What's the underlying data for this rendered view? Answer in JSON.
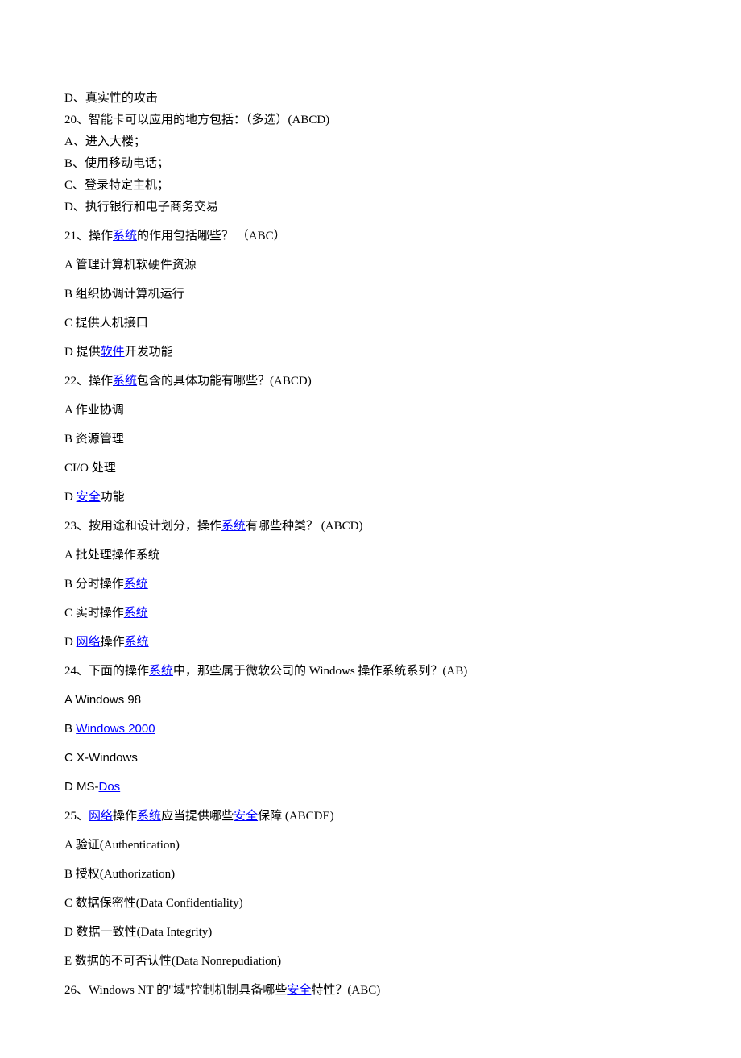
{
  "lines": {
    "l1": "D、真实性的攻击",
    "l2": "20、智能卡可以应用的地方包括：（多选）(ABCD)",
    "l3": "A、进入大楼；",
    "l4": "B、使用移动电话；",
    "l5": "C、登录特定主机；",
    "l6": "D、执行银行和电子商务交易",
    "l7a": "21、操作",
    "l7_link": "系统",
    "l7b": "的作用包括哪些？ （ABC）",
    "l8": "A 管理计算机软硬件资源",
    "l9": "B 组织协调计算机运行",
    "l10": "C 提供人机接口",
    "l11a": "D 提供",
    "l11_link": "软件",
    "l11b": "开发功能",
    "l12a": "22、操作",
    "l12_link": "系统",
    "l12b": "包含的具体功能有哪些？(ABCD)",
    "l13": "A 作业协调",
    "l14": "B 资源管理",
    "l15": "CI/O 处理",
    "l16a": "D ",
    "l16_link": "安全",
    "l16b": "功能",
    "l17a": "23、按用途和设计划分，操作",
    "l17_link": "系统",
    "l17b": "有哪些种类？   (ABCD)",
    "l18": "A 批处理操作系统",
    "l19a": "B 分时操作",
    "l19_link": "系统",
    "l20a": "C 实时操作",
    "l20_link": "系统",
    "l21a": "D ",
    "l21_link1": "网络",
    "l21b": "操作",
    "l21_link2": "系统",
    "l22a": "24、下面的操作",
    "l22_link": "系统",
    "l22b": "中，那些属于微软公司的 Windows 操作系统系列？(AB)",
    "l23": "A  Windows  98",
    "l24a": "B  ",
    "l24_link": "Windows  2000",
    "l25": "C  X-Windows",
    "l26a": "D  MS-",
    "l26_link": "Dos",
    "l27a": "25、",
    "l27_link1": "网络",
    "l27b": "操作",
    "l27_link2": "系统",
    "l27c": "应当提供哪些",
    "l27_link3": "安全",
    "l27d": "保障      (ABCDE)",
    "l28": "A  验证(Authentication)",
    "l29": "B  授权(Authorization)",
    "l30": "C  数据保密性(Data  Confidentiality)",
    "l31": "D  数据一致性(Data  Integrity)",
    "l32": "E  数据的不可否认性(Data  Nonrepudiation)",
    "l33a": "26、Windows  NT 的\"域\"控制机制具备哪些",
    "l33_link": "安全",
    "l33b": "特性？(ABC)"
  }
}
